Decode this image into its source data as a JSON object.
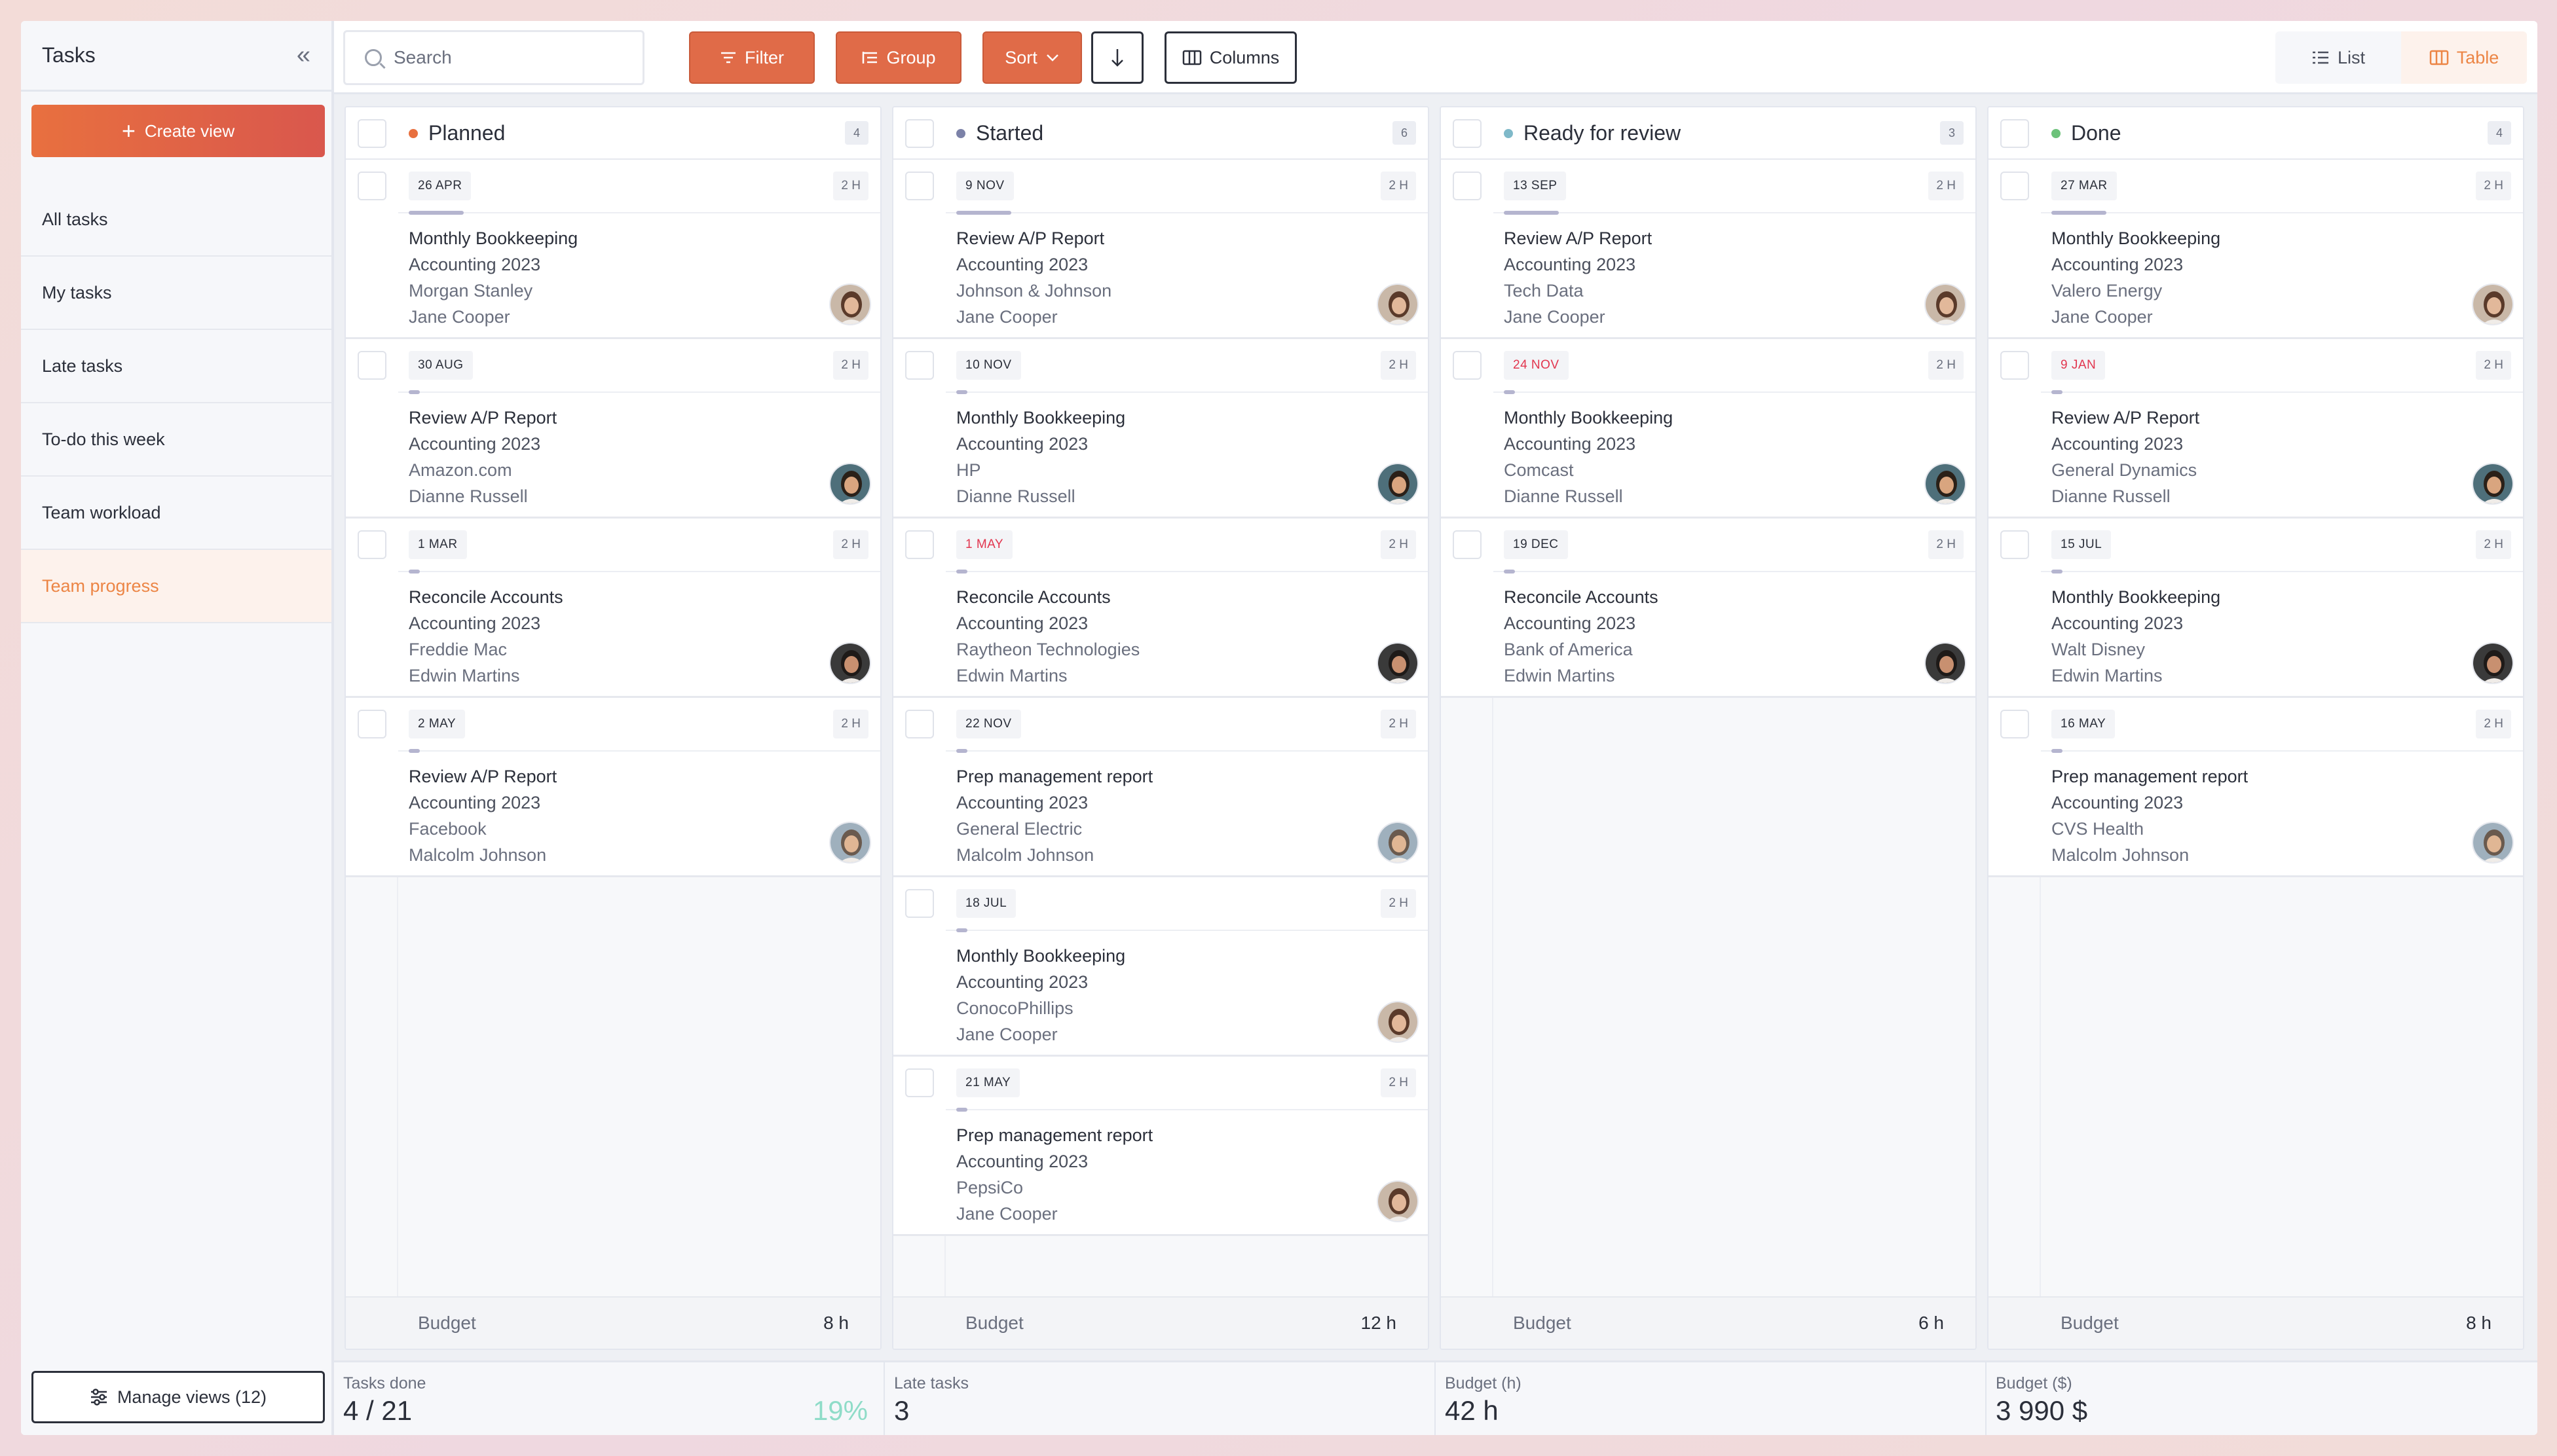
{
  "sidebar": {
    "title": "Tasks",
    "create_label": "Create view",
    "items": [
      {
        "label": "All tasks"
      },
      {
        "label": "My tasks"
      },
      {
        "label": "Late tasks"
      },
      {
        "label": "To-do this week"
      },
      {
        "label": "Team workload"
      },
      {
        "label": "Team progress",
        "active": true
      }
    ],
    "manage_label": "Manage views (12)"
  },
  "toolbar": {
    "search_placeholder": "Search",
    "filter_label": "Filter",
    "group_label": "Group",
    "sort_label": "Sort",
    "columns_label": "Columns",
    "list_label": "List",
    "table_label": "Table"
  },
  "colors": {
    "accent": "#ec8545",
    "planned": "#e8703f",
    "started": "#7c82a8",
    "ready": "#7fb9c9",
    "done": "#6cc27a",
    "late_date": "#e2364f"
  },
  "columns": [
    {
      "title": "Planned",
      "count": "4",
      "budget_label": "Budget",
      "budget": "8 h",
      "dot": "#e8703f",
      "cards": [
        {
          "date": "26 APR",
          "hours": "2 H",
          "progress": 0.4,
          "task": "Monthly Bookkeeping",
          "project": "Accounting 2023",
          "client": "Morgan Stanley",
          "person": "Jane Cooper",
          "avatar": "jane"
        },
        {
          "date": "30 AUG",
          "hours": "2 H",
          "progress": 0.08,
          "task": "Review A/P Report",
          "project": "Accounting 2023",
          "client": "Amazon.com",
          "person": "Dianne Russell",
          "avatar": "dianne"
        },
        {
          "date": "1 MAR",
          "hours": "2 H",
          "progress": 0.08,
          "task": "Reconcile Accounts",
          "project": "Accounting 2023",
          "client": "Freddie Mac",
          "person": "Edwin Martins",
          "avatar": "edwin"
        },
        {
          "date": "2 MAY",
          "hours": "2 H",
          "progress": 0.08,
          "task": "Review A/P Report",
          "project": "Accounting 2023",
          "client": "Facebook",
          "person": "Malcolm Johnson",
          "avatar": "malcolm"
        }
      ]
    },
    {
      "title": "Started",
      "count": "6",
      "budget_label": "Budget",
      "budget": "12 h",
      "dot": "#7c82a8",
      "cards": [
        {
          "date": "9 NOV",
          "hours": "2 H",
          "progress": 0.4,
          "task": "Review A/P Report",
          "project": "Accounting 2023",
          "client": "Johnson & Johnson",
          "person": "Jane Cooper",
          "avatar": "jane"
        },
        {
          "date": "10 NOV",
          "hours": "2 H",
          "progress": 0.08,
          "task": "Monthly Bookkeeping",
          "project": "Accounting 2023",
          "client": "HP",
          "person": "Dianne Russell",
          "avatar": "dianne"
        },
        {
          "date": "1 MAY",
          "hours": "2 H",
          "progress": 0.08,
          "late": true,
          "task": "Reconcile Accounts",
          "project": "Accounting 2023",
          "client": "Raytheon Technologies",
          "person": "Edwin Martins",
          "avatar": "edwin"
        },
        {
          "date": "22 NOV",
          "hours": "2 H",
          "progress": 0.08,
          "task": "Prep management report",
          "project": "Accounting 2023",
          "client": "General Electric",
          "person": "Malcolm Johnson",
          "avatar": "malcolm"
        },
        {
          "date": "18 JUL",
          "hours": "2 H",
          "progress": 0.08,
          "task": "Monthly Bookkeeping",
          "project": "Accounting 2023",
          "client": "ConocoPhillips",
          "person": "Jane Cooper",
          "avatar": "jane"
        },
        {
          "date": "21 MAY",
          "hours": "2 H",
          "progress": 0.08,
          "task": "Prep management report",
          "project": "Accounting 2023",
          "client": "PepsiCo",
          "person": "Jane Cooper",
          "avatar": "jane"
        }
      ]
    },
    {
      "title": "Ready for review",
      "count": "3",
      "budget_label": "Budget",
      "budget": "6 h",
      "dot": "#7fb9c9",
      "cards": [
        {
          "date": "13 SEP",
          "hours": "2 H",
          "progress": 0.4,
          "task": "Review A/P Report",
          "project": "Accounting 2023",
          "client": "Tech Data",
          "person": "Jane Cooper",
          "avatar": "jane"
        },
        {
          "date": "24 NOV",
          "hours": "2 H",
          "progress": 0.08,
          "late": true,
          "task": "Monthly Bookkeeping",
          "project": "Accounting 2023",
          "client": "Comcast",
          "person": "Dianne Russell",
          "avatar": "dianne"
        },
        {
          "date": "19 DEC",
          "hours": "2 H",
          "progress": 0.08,
          "task": "Reconcile Accounts",
          "project": "Accounting 2023",
          "client": "Bank of America",
          "person": "Edwin Martins",
          "avatar": "edwin"
        }
      ]
    },
    {
      "title": "Done",
      "count": "4",
      "budget_label": "Budget",
      "budget": "8 h",
      "dot": "#6cc27a",
      "cards": [
        {
          "date": "27 MAR",
          "hours": "2 H",
          "progress": 0.4,
          "task": "Monthly Bookkeeping",
          "project": "Accounting 2023",
          "client": "Valero Energy",
          "person": "Jane Cooper",
          "avatar": "jane"
        },
        {
          "date": "9 JAN",
          "hours": "2 H",
          "progress": 0.08,
          "late": true,
          "task": "Review A/P Report",
          "project": "Accounting 2023",
          "client": "General Dynamics",
          "person": "Dianne Russell",
          "avatar": "dianne"
        },
        {
          "date": "15 JUL",
          "hours": "2 H",
          "progress": 0.08,
          "task": "Monthly Bookkeeping",
          "project": "Accounting 2023",
          "client": "Walt Disney",
          "person": "Edwin Martins",
          "avatar": "edwin"
        },
        {
          "date": "16 MAY",
          "hours": "2 H",
          "progress": 0.08,
          "task": "Prep management report",
          "project": "Accounting 2023",
          "client": "CVS Health",
          "person": "Malcolm Johnson",
          "avatar": "malcolm"
        }
      ]
    }
  ],
  "summary": [
    {
      "label": "Tasks done",
      "value": "4 / 21",
      "pct": "19%"
    },
    {
      "label": "Late tasks",
      "value": "3"
    },
    {
      "label": "Budget (h)",
      "value": "42 h"
    },
    {
      "label": "Budget ($)",
      "value": "3 990 $"
    }
  ]
}
